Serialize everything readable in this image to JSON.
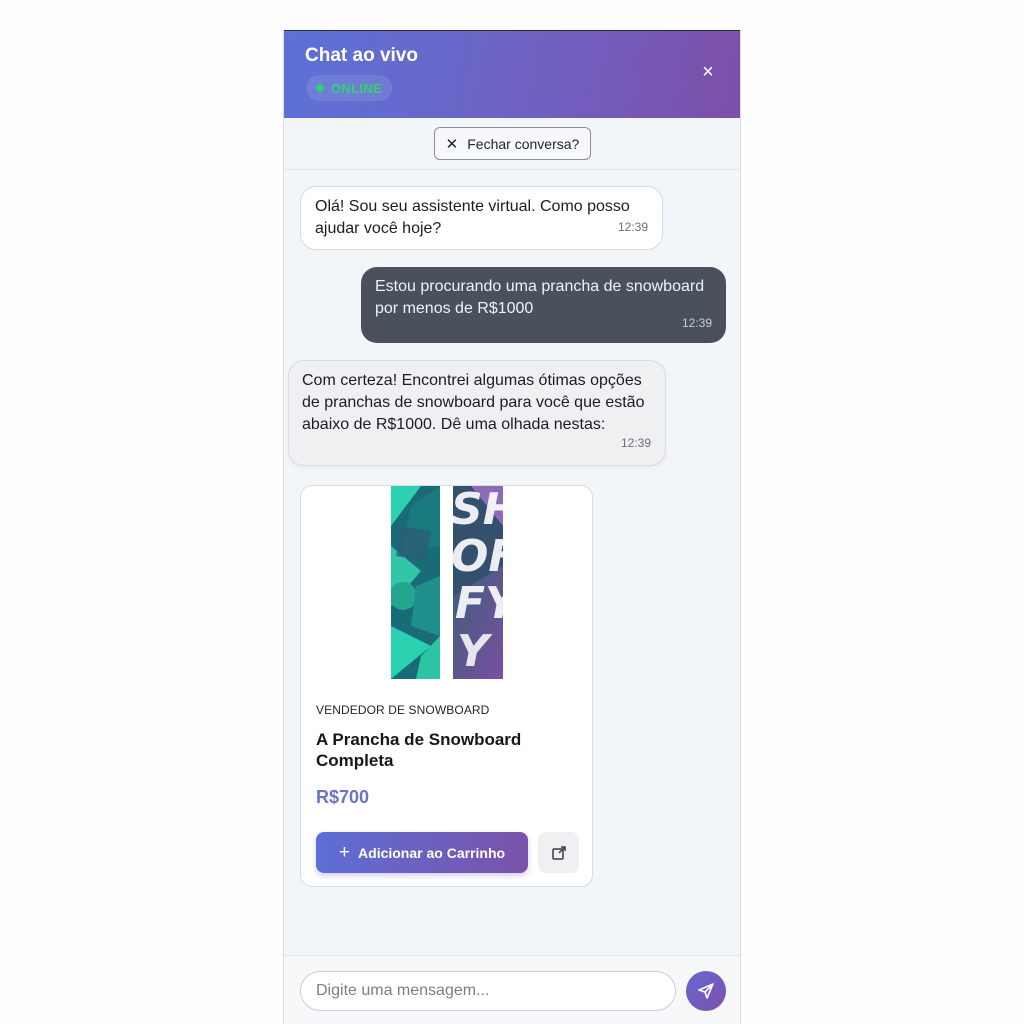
{
  "header": {
    "title": "Chat ao vivo",
    "status": "ONLINE",
    "status_color": "#2fd36f",
    "close_icon": "close-icon"
  },
  "close_conversation": {
    "icon": "close-icon",
    "label": "Fechar conversa?"
  },
  "messages": [
    {
      "sender": "bot",
      "text": "Olá! Sou seu assistente virtual. Como posso ajudar você hoje?",
      "time": "12:39"
    },
    {
      "sender": "user",
      "text": "Estou procurando uma prancha de snowboard por menos de R$1000",
      "time": "12:39"
    },
    {
      "sender": "bot",
      "text": "Com certeza! Encontrei algumas ótimas opções de pranchas de snowboard para você que estão abaixo de R$1000. Dê uma olhada nestas:",
      "time": "12:39"
    }
  ],
  "product": {
    "vendor": "VENDEDOR DE SNOWBOARD",
    "name": "A Prancha de Snowboard Completa",
    "price": "R$700",
    "price_color": "#6a73c9",
    "image_icon": "snowboard-image",
    "add_to_cart": "Adicionar ao Carrinho",
    "add_icon": "plus-icon",
    "share_icon": "external-link-icon"
  },
  "composer": {
    "placeholder": "Digite uma mensagem...",
    "value": "",
    "send_icon": "send-icon"
  },
  "colors": {
    "header_start": "#5b72d8",
    "header_end": "#7c4fa8",
    "user_bubble": "#4a515d",
    "bot_bubble": "#ffffff"
  }
}
